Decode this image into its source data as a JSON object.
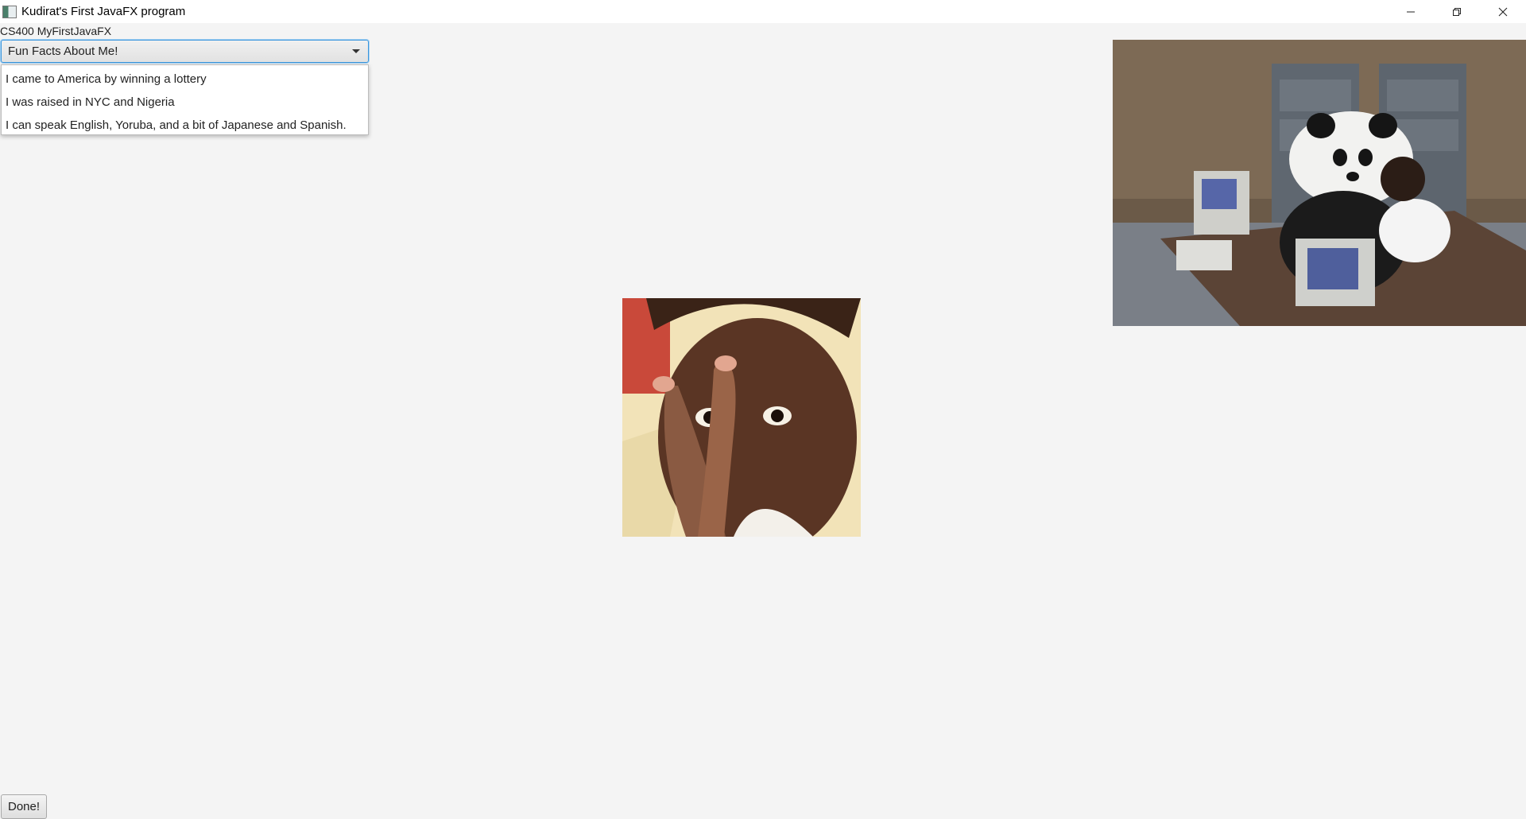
{
  "window": {
    "title": "Kudirat's First JavaFX program",
    "controls": {
      "minimize": "minimize-icon",
      "restore": "restore-icon",
      "close": "close-icon"
    }
  },
  "main": {
    "heading": "CS400 MyFirstJavaFX",
    "combo": {
      "value": "Fun Facts About Me!",
      "options": [
        "I came to America by winning a lottery",
        "I was raised in NYC and Nigeria",
        "I can speak English, Yoruba, and a bit of Japanese and Spanish."
      ]
    },
    "done_label": "Done!"
  },
  "colors": {
    "background": "#f4f4f4",
    "focus_border": "#3a96dd"
  }
}
